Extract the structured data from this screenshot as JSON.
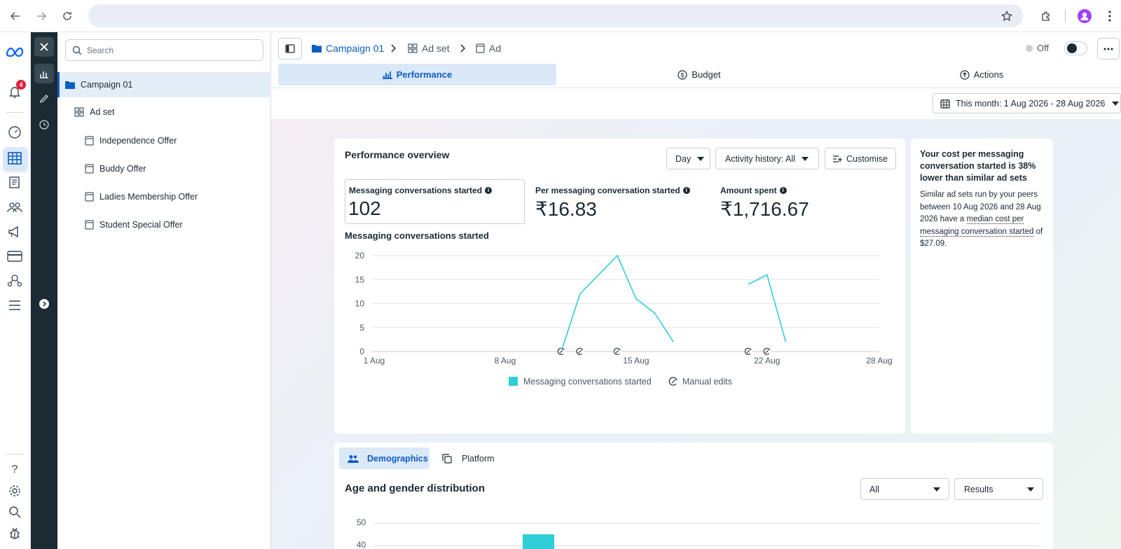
{
  "browser": {
    "back_icon": "arrow-left-icon",
    "forward_icon": "arrow-right-icon",
    "reload_icon": "reload-icon",
    "url": ""
  },
  "rail": {
    "notification_count": "4",
    "help": "?"
  },
  "tree": {
    "search_placeholder": "Search",
    "campaign": "Campaign 01",
    "adset": "Ad set",
    "ads": [
      "Independence Offer",
      "Buddy Offer",
      "Ladies Membership Offer",
      "Student Special Offer"
    ]
  },
  "breadcrumb": {
    "campaign": "Campaign 01",
    "adset": "Ad set",
    "ad": "Ad"
  },
  "status": {
    "off_label": "Off"
  },
  "tabs": [
    {
      "label": "Performance",
      "active": true
    },
    {
      "label": "Budget",
      "active": false
    },
    {
      "label": "Actions",
      "active": false
    }
  ],
  "date_range": "This month: 1 Aug 2026 - 28 Aug 2026",
  "overview": {
    "title": "Performance overview",
    "day_label": "Day",
    "activity_label": "Activity history: All",
    "customise_label": "Customise",
    "metrics": [
      {
        "label": "Messaging conversations started",
        "value": "102"
      },
      {
        "label": "Per messaging conversation started",
        "value": "₹16.83"
      },
      {
        "label": "Amount spent",
        "value": "₹1,716.67"
      }
    ]
  },
  "chart_data": {
    "type": "line",
    "title": "Messaging conversations started",
    "ylim": [
      0,
      20
    ],
    "yticks": [
      0,
      5,
      10,
      15,
      20
    ],
    "xticks": [
      "1 Aug",
      "8 Aug",
      "15 Aug",
      "22 Aug",
      "28 Aug"
    ],
    "series": [
      {
        "name": "Messaging conversations started",
        "color": "#2ecfd6",
        "segments": [
          [
            [
              11,
              0
            ],
            [
              12,
              12
            ],
            [
              14,
              20
            ],
            [
              15,
              11
            ],
            [
              16,
              8
            ],
            [
              17,
              2
            ]
          ],
          [
            [
              21,
              14
            ],
            [
              22,
              16
            ],
            [
              23,
              2
            ]
          ]
        ]
      }
    ],
    "manual_edit_days": [
      11,
      12,
      14,
      21,
      22
    ],
    "legend": [
      "Messaging conversations started",
      "Manual edits"
    ],
    "grid": true
  },
  "insight": {
    "title": "Your cost per messaging conversation started is 38% lower than similar ad sets",
    "body_prefix": "Similar ad sets run by your peers between 10 Aug 2026 and 28 Aug 2026 have a ",
    "body_link": "median cost per messaging conversation started",
    "body_suffix": " of $27.09."
  },
  "breakdown": {
    "tabs": [
      "Demographics",
      "Platform"
    ],
    "title": "Age and gender distribution",
    "filter_all": "All",
    "filter_results": "Results",
    "yticks": [
      "50",
      "40"
    ]
  },
  "age_gender_chart": {
    "type": "bar",
    "ylim": [
      0,
      50
    ],
    "bar_color": "#2ecfd6"
  }
}
